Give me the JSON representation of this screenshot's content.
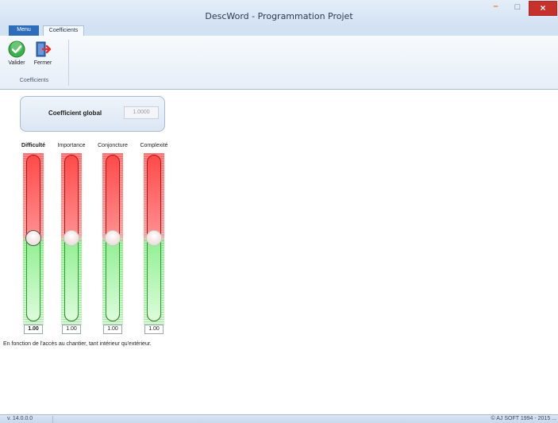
{
  "window": {
    "title": "DescWord - Programmation Projet",
    "minimize_glyph": "–",
    "maximize_glyph": "□",
    "close_glyph": "×"
  },
  "tabs": [
    {
      "label": "Menu",
      "active": false
    },
    {
      "label": "Coefficients",
      "active": true
    }
  ],
  "ribbon": {
    "buttons": [
      {
        "label": "Valider",
        "icon": "check-circle-icon",
        "color": "#2fa23a"
      },
      {
        "label": "Fermer",
        "icon": "exit-door-icon",
        "color": "#2e5ea8"
      }
    ],
    "group_label": "Coefficients"
  },
  "global": {
    "label": "Coefficient global",
    "value": "1.0000"
  },
  "sliders": [
    {
      "label": "Difficulté",
      "value": "1.00",
      "selected": true
    },
    {
      "label": "Importance",
      "value": "1.00",
      "selected": false
    },
    {
      "label": "Conjoncture",
      "value": "1.00",
      "selected": false
    },
    {
      "label": "Complexité",
      "value": "1.00",
      "selected": false
    }
  ],
  "description": "En fonction de l'accès au chantier, tant intérieur qu'extérieur.",
  "status": {
    "version": "v. 14.0.0.0",
    "copyright": "© AJ SOFT 1994 - 2015 ..."
  },
  "colors": {
    "slider_high": "#ff4a4a",
    "slider_low": "#98f098",
    "menu_tab": "#2d6dbc"
  }
}
